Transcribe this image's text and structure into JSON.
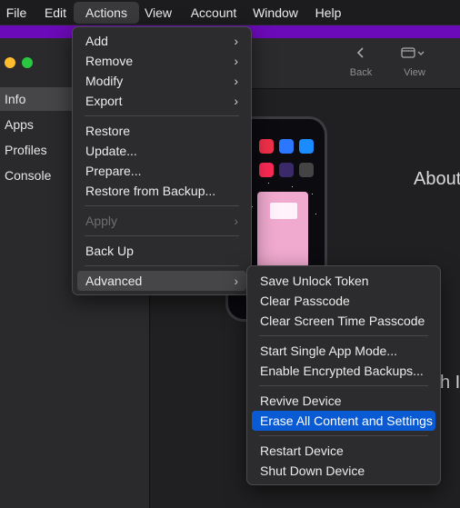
{
  "menubar": {
    "items": [
      {
        "label": "File"
      },
      {
        "label": "Edit"
      },
      {
        "label": "Actions"
      },
      {
        "label": "View"
      },
      {
        "label": "Account"
      },
      {
        "label": "Window"
      },
      {
        "label": "Help"
      }
    ],
    "active_index": 2
  },
  "sidebar": {
    "items": [
      {
        "label": "Info"
      },
      {
        "label": "Apps"
      },
      {
        "label": "Profiles"
      },
      {
        "label": "Console"
      }
    ],
    "selected_index": 0
  },
  "toolbar": {
    "back_label": "Back",
    "view_label": "View"
  },
  "content": {
    "about_text": "About",
    "partial_text": "h I"
  },
  "actions_menu": {
    "items": [
      {
        "label": "Add",
        "submenu": true
      },
      {
        "label": "Remove",
        "submenu": true
      },
      {
        "label": "Modify",
        "submenu": true
      },
      {
        "label": "Export",
        "submenu": true
      },
      {
        "label": "Restore"
      },
      {
        "label": "Update..."
      },
      {
        "label": "Prepare..."
      },
      {
        "label": "Restore from Backup..."
      },
      {
        "label": "Apply",
        "submenu": true,
        "disabled": true
      },
      {
        "label": "Back Up"
      },
      {
        "label": "Advanced",
        "submenu": true,
        "hovered": true
      }
    ]
  },
  "advanced_menu": {
    "items": [
      {
        "label": "Save Unlock Token"
      },
      {
        "label": "Clear Passcode"
      },
      {
        "label": "Clear Screen Time Passcode"
      },
      {
        "label": "Start Single App Mode..."
      },
      {
        "label": "Enable Encrypted Backups..."
      },
      {
        "label": "Revive Device"
      },
      {
        "label": "Erase All Content and Settings",
        "highlighted": true
      },
      {
        "label": "Restart Device"
      },
      {
        "label": "Shut Down Device"
      }
    ]
  },
  "colors": {
    "accent_highlight": "#0a5bd3",
    "window_strip": "#6b0ab8",
    "traffic_yellow": "#febc2e",
    "traffic_green": "#28c840"
  },
  "icons": {
    "submenu_chevron": "chevron-right-icon",
    "back": "chevron-left-icon",
    "view": "view-toggle-icon"
  }
}
